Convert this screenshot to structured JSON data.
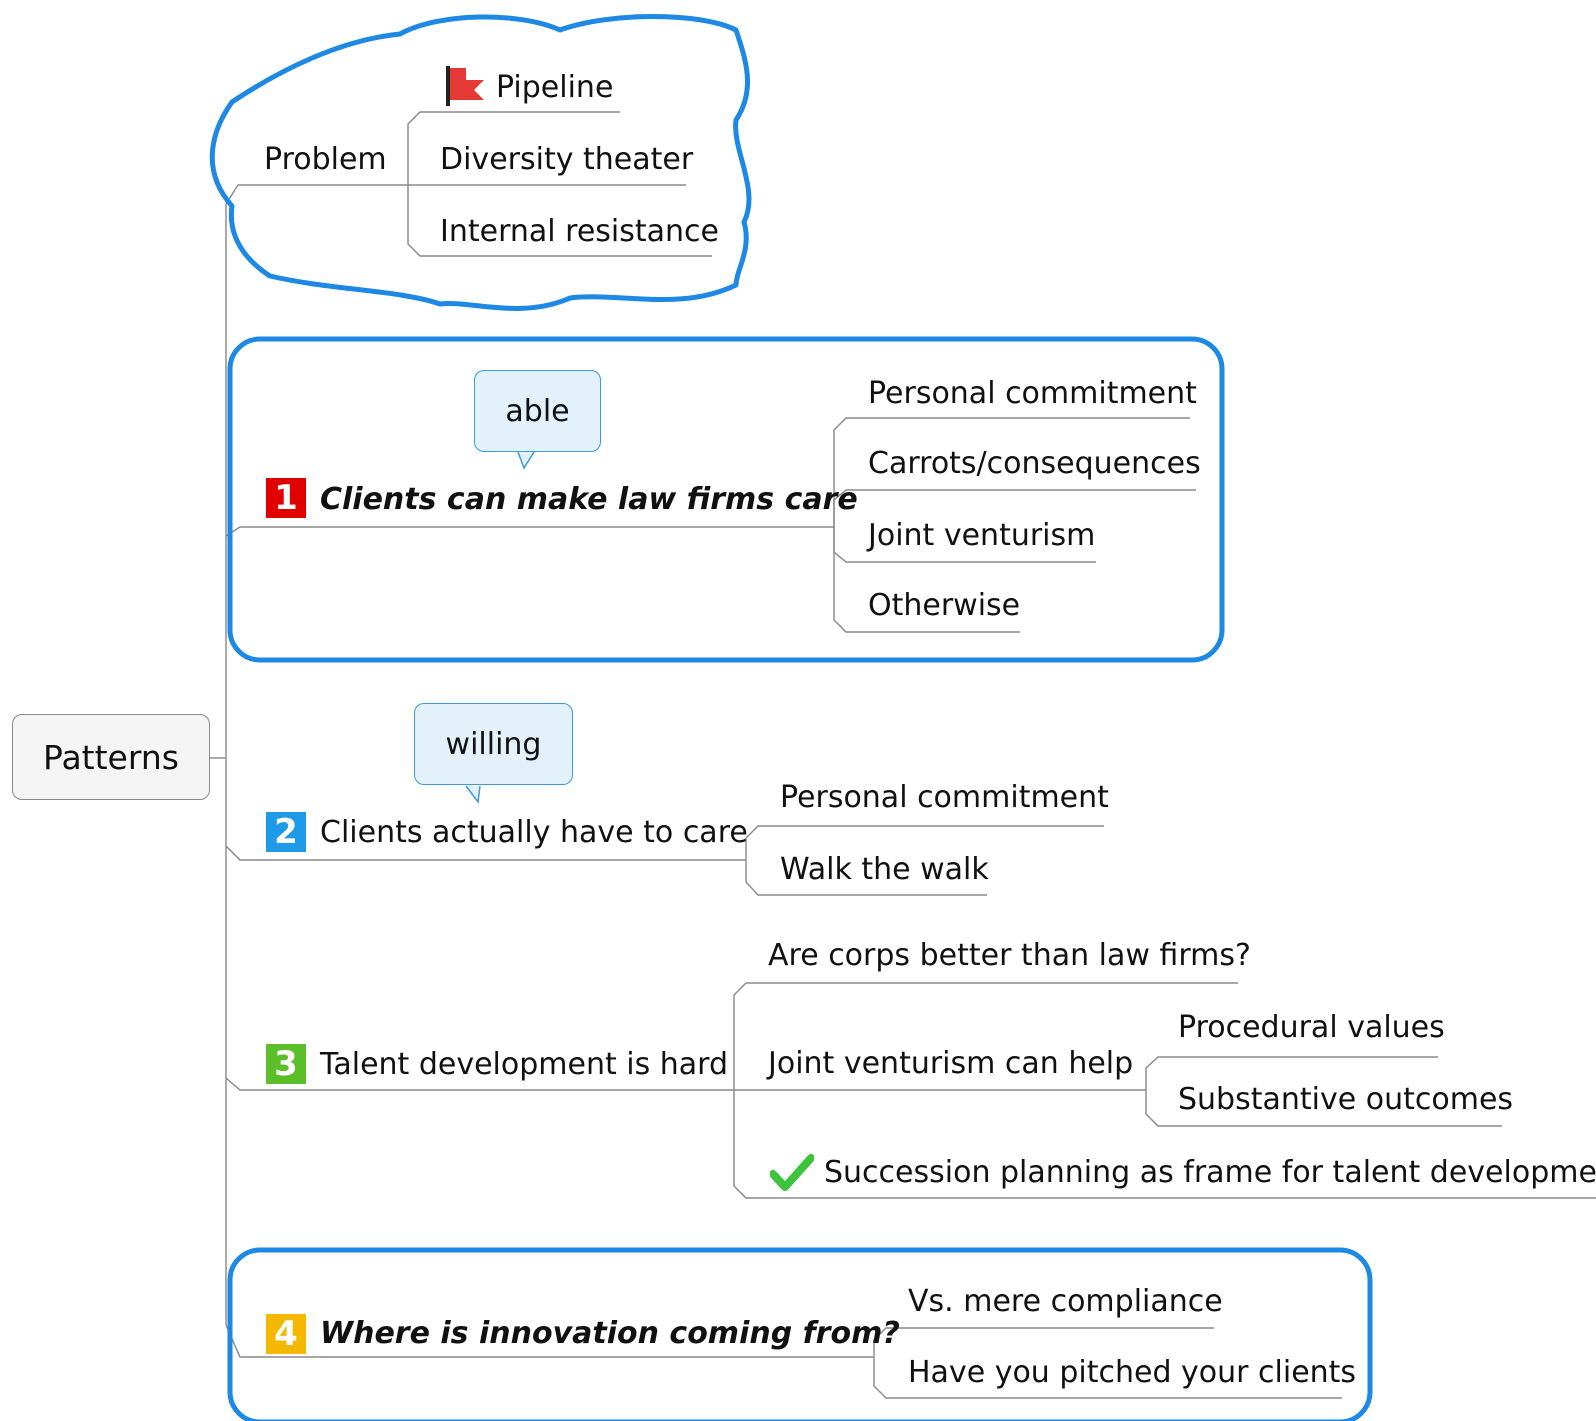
{
  "root": {
    "label": "Patterns"
  },
  "problem": {
    "label": "Problem",
    "children": [
      "Pipeline",
      "Diversity theater",
      "Internal resistance"
    ],
    "flag_color": "#e53935"
  },
  "topic1": {
    "number": "1",
    "label": "Clients can make law firms care",
    "callout": "able",
    "badge_color": "#e00000",
    "children": [
      "Personal commitment",
      "Carrots/consequences",
      "Joint venturism",
      "Otherwise"
    ]
  },
  "topic2": {
    "number": "2",
    "label": "Clients actually have to care",
    "callout": "willing",
    "badge_color": "#1e9be8",
    "children": [
      "Personal commitment",
      "Walk the walk"
    ]
  },
  "topic3": {
    "number": "3",
    "label": "Talent development is hard",
    "badge_color": "#5cbf2a",
    "children": [
      "Are corps better than law firms?",
      "Joint venturism can help",
      "Succession planning as frame for talent development"
    ],
    "grandchildren": [
      "Procedural values",
      "Substantive outcomes"
    ],
    "check_color": "#3cc43c"
  },
  "topic4": {
    "number": "4",
    "label": "Where is innovation coming from?",
    "badge_color": "#f5b800",
    "children": [
      "Vs. mere compliance",
      "Have you pitched your clients"
    ]
  },
  "colors": {
    "boundary": "#1e88e5",
    "line": "#777777",
    "callout_fill": "#e3f1fb"
  }
}
